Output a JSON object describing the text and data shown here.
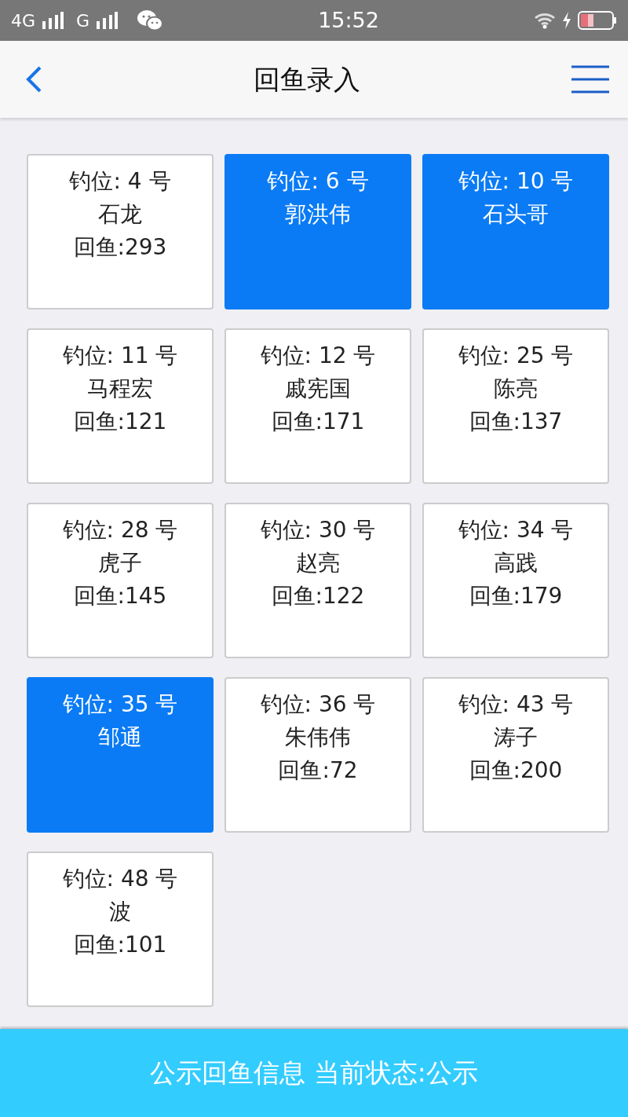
{
  "status_bar": {
    "network_1": "4G",
    "network_2": "G",
    "time": "15:52"
  },
  "header": {
    "title": "回鱼录入"
  },
  "spots": [
    {
      "spot": "钓位: 4 号",
      "name": "石龙",
      "catch": "回鱼:293",
      "selected": false
    },
    {
      "spot": "钓位: 6 号",
      "name": "郭洪伟",
      "selected": true
    },
    {
      "spot": "钓位: 10 号",
      "name": "石头哥",
      "selected": true
    },
    {
      "spot": "钓位: 11 号",
      "name": "马程宏",
      "catch": "回鱼:121",
      "selected": false
    },
    {
      "spot": "钓位: 12 号",
      "name": "戚宪国",
      "catch": "回鱼:171",
      "selected": false
    },
    {
      "spot": "钓位: 25 号",
      "name": "陈亮",
      "catch": "回鱼:137",
      "selected": false
    },
    {
      "spot": "钓位: 28 号",
      "name": "虎子",
      "catch": "回鱼:145",
      "selected": false
    },
    {
      "spot": "钓位: 30 号",
      "name": "赵亮",
      "catch": "回鱼:122",
      "selected": false
    },
    {
      "spot": "钓位: 34 号",
      "name": "高践",
      "catch": "回鱼:179",
      "selected": false
    },
    {
      "spot": "钓位: 35 号",
      "name": "邹通",
      "selected": true
    },
    {
      "spot": "钓位: 36 号",
      "name": "朱伟伟",
      "catch": "回鱼:72",
      "selected": false
    },
    {
      "spot": "钓位: 43 号",
      "name": "涛子",
      "catch": "回鱼:200",
      "selected": false
    },
    {
      "spot": "钓位: 48 号",
      "name": "波",
      "catch": "回鱼:101",
      "selected": false
    }
  ],
  "footer_button": "公示回鱼信息 当前状态:公示"
}
